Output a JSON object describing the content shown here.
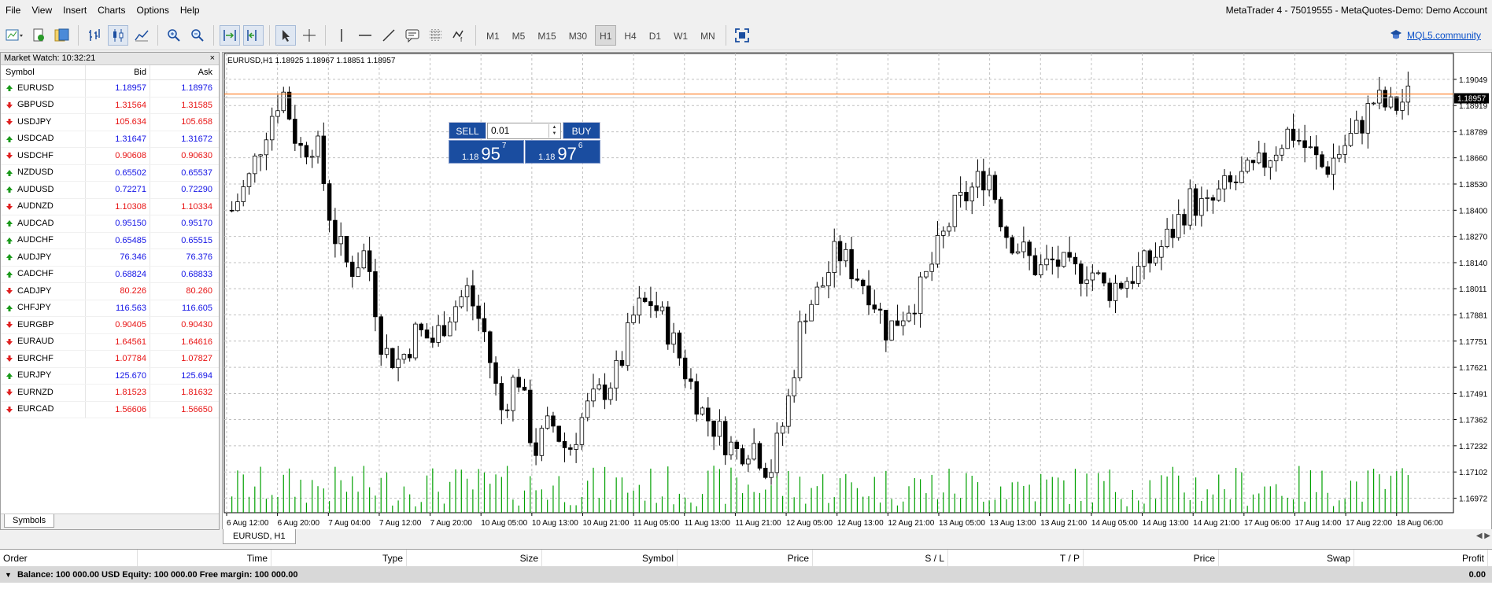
{
  "app": {
    "title": "MetaTrader 4 - 75019555 - MetaQuotes-Demo: Demo Account",
    "menu": [
      "File",
      "View",
      "Insert",
      "Charts",
      "Options",
      "Help"
    ]
  },
  "toolbar": {
    "timeframes": [
      "M1",
      "M5",
      "M15",
      "M30",
      "H1",
      "H4",
      "D1",
      "W1",
      "MN"
    ],
    "active_timeframe": "H1",
    "community_link": "MQL5.community",
    "icons": [
      "new-chart-icon",
      "profiles-icon",
      "new-order-icon",
      "market-watch-icon",
      "bar-chart-icon",
      "candlestick-icon",
      "line-chart-icon",
      "zoom-in-icon",
      "zoom-out-icon",
      "auto-scroll-icon",
      "chart-shift-icon",
      "cursor-icon",
      "crosshair-icon",
      "vertical-line-icon",
      "horizontal-line-icon",
      "trendline-icon",
      "text-icon",
      "grid-icon",
      "indicators-icon",
      "fullscreen-icon"
    ]
  },
  "market_watch": {
    "title": "Market Watch: 10:32:21",
    "columns": {
      "symbol": "Symbol",
      "bid": "Bid",
      "ask": "Ask"
    },
    "close": "×",
    "rows": [
      {
        "symbol": "EURUSD",
        "bid": "1.18957",
        "ask": "1.18976",
        "dir": "up"
      },
      {
        "symbol": "GBPUSD",
        "bid": "1.31564",
        "ask": "1.31585",
        "dir": "dn"
      },
      {
        "symbol": "USDJPY",
        "bid": "105.634",
        "ask": "105.658",
        "dir": "dn"
      },
      {
        "symbol": "USDCAD",
        "bid": "1.31647",
        "ask": "1.31672",
        "dir": "up"
      },
      {
        "symbol": "USDCHF",
        "bid": "0.90608",
        "ask": "0.90630",
        "dir": "dn"
      },
      {
        "symbol": "NZDUSD",
        "bid": "0.65502",
        "ask": "0.65537",
        "dir": "up"
      },
      {
        "symbol": "AUDUSD",
        "bid": "0.72271",
        "ask": "0.72290",
        "dir": "up"
      },
      {
        "symbol": "AUDNZD",
        "bid": "1.10308",
        "ask": "1.10334",
        "dir": "dn"
      },
      {
        "symbol": "AUDCAD",
        "bid": "0.95150",
        "ask": "0.95170",
        "dir": "up"
      },
      {
        "symbol": "AUDCHF",
        "bid": "0.65485",
        "ask": "0.65515",
        "dir": "up"
      },
      {
        "symbol": "AUDJPY",
        "bid": "76.346",
        "ask": "76.376",
        "dir": "up"
      },
      {
        "symbol": "CADCHF",
        "bid": "0.68824",
        "ask": "0.68833",
        "dir": "up"
      },
      {
        "symbol": "CADJPY",
        "bid": "80.226",
        "ask": "80.260",
        "dir": "dn"
      },
      {
        "symbol": "CHFJPY",
        "bid": "116.563",
        "ask": "116.605",
        "dir": "up"
      },
      {
        "symbol": "EURGBP",
        "bid": "0.90405",
        "ask": "0.90430",
        "dir": "dn"
      },
      {
        "symbol": "EURAUD",
        "bid": "1.64561",
        "ask": "1.64616",
        "dir": "dn"
      },
      {
        "symbol": "EURCHF",
        "bid": "1.07784",
        "ask": "1.07827",
        "dir": "dn"
      },
      {
        "symbol": "EURJPY",
        "bid": "125.670",
        "ask": "125.694",
        "dir": "up"
      },
      {
        "symbol": "EURNZD",
        "bid": "1.81523",
        "ask": "1.81632",
        "dir": "dn"
      },
      {
        "symbol": "EURCAD",
        "bid": "1.56606",
        "ask": "1.56650",
        "dir": "dn"
      }
    ],
    "tab": "Symbols"
  },
  "chart": {
    "header": "EURUSD,H1  1.18925 1.18967 1.18851 1.18957",
    "tab": "EURUSD, H1",
    "current_price": "1.18957",
    "one_click": {
      "sell": "SELL",
      "buy": "BUY",
      "lot": "0.01",
      "sell_price": {
        "small": "1.18",
        "big": "95",
        "pip": "7"
      },
      "buy_price": {
        "small": "1.18",
        "big": "97",
        "pip": "6"
      }
    },
    "colors": {
      "bull": "#ffffff",
      "bear": "#000000",
      "volume": "#00a000",
      "bid_line": "#c0c0c0",
      "ask_line": "#ff6a00",
      "grid": "#c0c0c0"
    }
  },
  "chart_data": {
    "type": "candlestick",
    "symbol": "EURUSD",
    "timeframe": "H1",
    "ylim": [
      1.169,
      1.1915
    ],
    "y_ticks": [
      "1.19049",
      "1.18919",
      "1.18789",
      "1.18660",
      "1.18530",
      "1.18400",
      "1.18270",
      "1.18140",
      "1.18011",
      "1.17881",
      "1.17751",
      "1.17621",
      "1.17491",
      "1.17362",
      "1.17232",
      "1.17102",
      "1.16972"
    ],
    "x_ticks": [
      "6 Aug 12:00",
      "6 Aug 20:00",
      "7 Aug 04:00",
      "7 Aug 12:00",
      "7 Aug 20:00",
      "10 Aug 05:00",
      "10 Aug 13:00",
      "10 Aug 21:00",
      "11 Aug 05:00",
      "11 Aug 13:00",
      "11 Aug 21:00",
      "12 Aug 05:00",
      "12 Aug 13:00",
      "12 Aug 21:00",
      "13 Aug 05:00",
      "13 Aug 13:00",
      "13 Aug 21:00",
      "14 Aug 05:00",
      "14 Aug 13:00",
      "14 Aug 21:00",
      "17 Aug 06:00",
      "17 Aug 14:00",
      "17 Aug 22:00",
      "18 Aug 06:00"
    ],
    "close_path": [
      1.184,
      1.1855,
      1.188,
      1.19,
      1.187,
      1.1875,
      1.183,
      1.181,
      1.182,
      1.177,
      1.1765,
      1.178,
      1.1775,
      1.179,
      1.18,
      1.178,
      1.174,
      1.176,
      1.172,
      1.1735,
      1.172,
      1.174,
      1.175,
      1.176,
      1.179,
      1.1795,
      1.178,
      1.176,
      1.174,
      1.173,
      1.172,
      1.1725,
      1.171,
      1.174,
      1.179,
      1.18,
      1.182,
      1.181,
      1.18,
      1.178,
      1.179,
      1.18,
      1.182,
      1.184,
      1.185,
      1.186,
      1.183,
      1.182,
      1.181,
      1.1815,
      1.1808,
      1.1812,
      1.18,
      1.1805,
      1.181,
      1.1818,
      1.183,
      1.1845,
      1.184,
      1.185,
      1.1855,
      1.186,
      1.187,
      1.188,
      1.187,
      1.186,
      1.187,
      1.188,
      1.1895,
      1.189,
      1.1896
    ],
    "last_price": 1.18957,
    "ask_price": 1.18976
  },
  "terminal": {
    "columns": [
      "Order",
      "Time",
      "Type",
      "Size",
      "Symbol",
      "Price",
      "S / L",
      "T / P",
      "Price",
      "Swap",
      "Profit"
    ],
    "balance_line": "Balance: 100 000.00 USD  Equity: 100 000.00  Free margin: 100 000.00",
    "profit": "0.00"
  }
}
